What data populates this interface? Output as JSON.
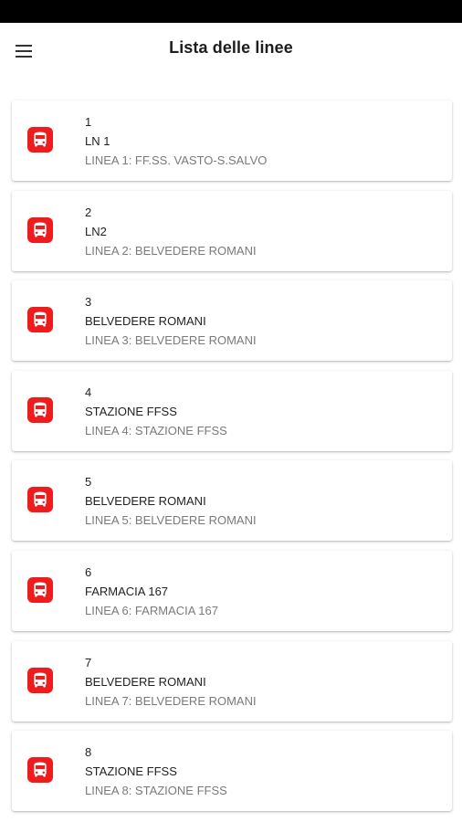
{
  "header": {
    "title": "Lista delle linee",
    "menu_icon": "hamburger-menu-icon"
  },
  "accent_color": "#ee1c1c",
  "lines": [
    {
      "number": "1",
      "name": "LN 1",
      "description": "LINEA 1: FF.SS. VASTO-S.SALVO",
      "icon": "bus-icon"
    },
    {
      "number": "2",
      "name": "LN2",
      "description": "LINEA 2: BELVEDERE ROMANI",
      "icon": "bus-icon"
    },
    {
      "number": "3",
      "name": "BELVEDERE ROMANI",
      "description": "LINEA 3: BELVEDERE ROMANI",
      "icon": "bus-icon"
    },
    {
      "number": "4",
      "name": "STAZIONE FFSS",
      "description": "LINEA 4: STAZIONE FFSS",
      "icon": "bus-icon"
    },
    {
      "number": "5",
      "name": "BELVEDERE ROMANI",
      "description": "LINEA 5: BELVEDERE ROMANI",
      "icon": "bus-icon"
    },
    {
      "number": "6",
      "name": "FARMACIA 167",
      "description": "LINEA 6: FARMACIA 167",
      "icon": "bus-icon"
    },
    {
      "number": "7",
      "name": "BELVEDERE ROMANI",
      "description": "LINEA 7: BELVEDERE ROMANI",
      "icon": "bus-icon"
    },
    {
      "number": "8",
      "name": "STAZIONE FFSS",
      "description": "LINEA 8: STAZIONE FFSS",
      "icon": "bus-icon"
    }
  ]
}
